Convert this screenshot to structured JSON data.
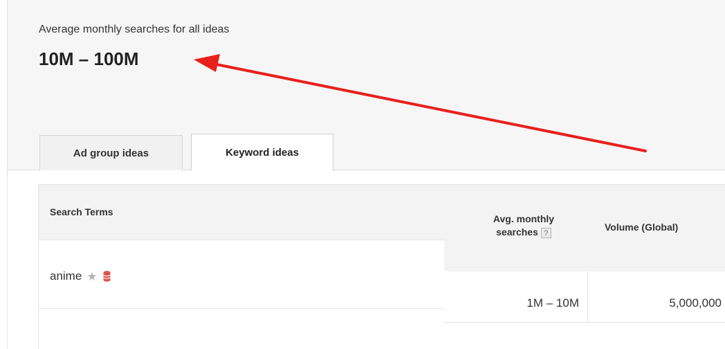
{
  "summary": {
    "label": "Average monthly searches for all ideas",
    "value": "10M – 100M"
  },
  "tabs": [
    {
      "label": "Ad group ideas",
      "active": false
    },
    {
      "label": "Keyword ideas",
      "active": true
    }
  ],
  "table": {
    "columns": {
      "search_terms": "Search Terms",
      "avg_monthly_line1": "Avg. monthly",
      "avg_monthly_line2": "searches",
      "volume": "Volume (Global)"
    },
    "help_icon": "?",
    "rows": [
      {
        "term": "anime",
        "star_icon": "star-icon",
        "db_icon": "database-icon",
        "avg_monthly": "1M – 10M",
        "volume": "5,000,000"
      }
    ]
  },
  "colors": {
    "annotation_arrow": "#e8201c",
    "database_icon": "#d9534f",
    "star_icon": "#b3b3b3"
  }
}
